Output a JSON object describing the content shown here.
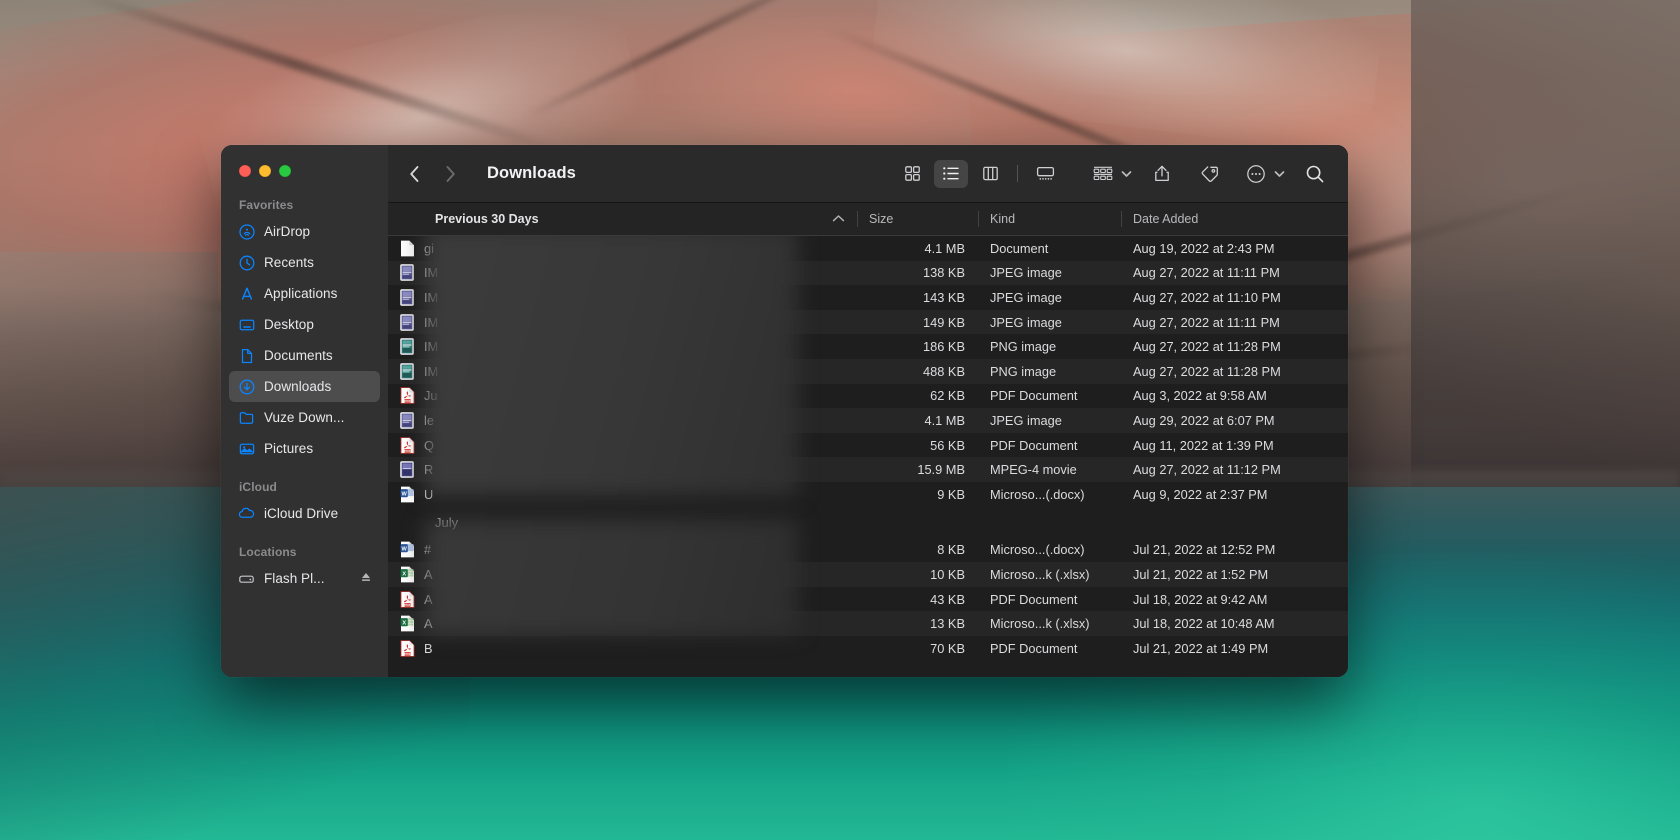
{
  "window": {
    "title": "Downloads",
    "traffic_lights": [
      "close",
      "minimize",
      "zoom"
    ]
  },
  "toolbar": {
    "back_label": "Back",
    "forward_label": "Forward",
    "views": [
      {
        "name": "icon-view",
        "label": "Icon View",
        "active": false
      },
      {
        "name": "list-view",
        "label": "List View",
        "active": true
      },
      {
        "name": "column-view",
        "label": "Column View",
        "active": false
      },
      {
        "name": "gallery-view",
        "label": "Gallery View",
        "active": false
      }
    ],
    "group_label": "Group",
    "share_label": "Share",
    "tag_label": "Tags",
    "more_label": "More",
    "search_label": "Search"
  },
  "sidebar": {
    "sections": [
      {
        "title": "Favorites",
        "items": [
          {
            "label": "AirDrop",
            "icon": "airdrop-icon",
            "selected": false
          },
          {
            "label": "Recents",
            "icon": "clock-icon",
            "selected": false
          },
          {
            "label": "Applications",
            "icon": "applications-icon",
            "selected": false
          },
          {
            "label": "Desktop",
            "icon": "desktop-icon",
            "selected": false
          },
          {
            "label": "Documents",
            "icon": "document-icon",
            "selected": false
          },
          {
            "label": "Downloads",
            "icon": "downloads-icon",
            "selected": true
          },
          {
            "label": "Vuze Down...",
            "icon": "folder-icon",
            "selected": false
          },
          {
            "label": "Pictures",
            "icon": "pictures-icon",
            "selected": false
          }
        ]
      },
      {
        "title": "iCloud",
        "items": [
          {
            "label": "iCloud Drive",
            "icon": "cloud-icon",
            "selected": false
          }
        ]
      },
      {
        "title": "Locations",
        "items": [
          {
            "label": "Flash Pl...",
            "icon": "drive-icon",
            "selected": false,
            "eject": true
          }
        ]
      }
    ]
  },
  "columns": {
    "name": "",
    "size": "Size",
    "kind": "Kind",
    "date_added": "Date Added",
    "sort_direction": "ascending"
  },
  "file_list": {
    "groups": [
      {
        "header": "Previous 30 Days",
        "rows": [
          {
            "name": "gi",
            "icon": "blank-document-icon",
            "size": "4.1 MB",
            "kind": "Document",
            "date": "Aug 19, 2022 at 2:43 PM"
          },
          {
            "name": "IM",
            "icon": "jpeg-thumbnail-icon",
            "size": "138 KB",
            "kind": "JPEG image",
            "date": "Aug 27, 2022 at 11:11 PM"
          },
          {
            "name": "IM",
            "icon": "jpeg-thumbnail-icon",
            "size": "143 KB",
            "kind": "JPEG image",
            "date": "Aug 27, 2022 at 11:10 PM"
          },
          {
            "name": "IM",
            "icon": "jpeg-thumbnail-icon",
            "size": "149 KB",
            "kind": "JPEG image",
            "date": "Aug 27, 2022 at 11:11 PM"
          },
          {
            "name": "IM",
            "icon": "png-thumbnail-icon",
            "size": "186 KB",
            "kind": "PNG image",
            "date": "Aug 27, 2022 at 11:28 PM"
          },
          {
            "name": "IM",
            "icon": "png-thumbnail-icon",
            "size": "488 KB",
            "kind": "PNG image",
            "date": "Aug 27, 2022 at 11:28 PM"
          },
          {
            "name": "Ju",
            "icon": "pdf-icon",
            "size": "62 KB",
            "kind": "PDF Document",
            "date": "Aug 3, 2022 at 9:58 AM"
          },
          {
            "name": "le",
            "icon": "jpeg-thumbnail-icon",
            "size": "4.1 MB",
            "kind": "JPEG image",
            "date": "Aug 29, 2022 at 6:07 PM"
          },
          {
            "name": "Q",
            "icon": "pdf-icon",
            "size": "56 KB",
            "kind": "PDF Document",
            "date": "Aug 11, 2022 at 1:39 PM"
          },
          {
            "name": "R",
            "icon": "movie-thumbnail-icon",
            "size": "15.9 MB",
            "kind": "MPEG-4 movie",
            "date": "Aug 27, 2022 at 11:12 PM"
          },
          {
            "name": "U",
            "icon": "word-icon",
            "size": "9 KB",
            "kind": "Microso...(.docx)",
            "date": "Aug 9, 2022 at 2:37 PM"
          }
        ]
      },
      {
        "header": "July",
        "rows": [
          {
            "name": "#",
            "icon": "word-icon",
            "size": "8 KB",
            "kind": "Microso...(.docx)",
            "date": "Jul 21, 2022 at 12:52 PM"
          },
          {
            "name": "A",
            "icon": "excel-icon",
            "size": "10 KB",
            "kind": "Microso...k (.xlsx)",
            "date": "Jul 21, 2022 at 1:52 PM"
          },
          {
            "name": "A",
            "icon": "pdf-icon",
            "size": "43 KB",
            "kind": "PDF Document",
            "date": "Jul 18, 2022 at 9:42 AM"
          },
          {
            "name": "A",
            "icon": "excel-icon",
            "size": "13 KB",
            "kind": "Microso...k (.xlsx)",
            "date": "Jul 18, 2022 at 10:48 AM"
          },
          {
            "name": "B",
            "icon": "pdf-icon",
            "size": "70 KB",
            "kind": "PDF Document",
            "date": "Jul 21, 2022 at 1:49 PM"
          }
        ]
      }
    ]
  },
  "colors": {
    "sidebar_accent": "#0a84ff",
    "window_bg": "#1e1e1e",
    "toolbar_bg": "#2a2a2a",
    "row_stripe": "#262626",
    "selection": "rgba(255,255,255,.14)",
    "traffic_red": "#ff5f57",
    "traffic_yellow": "#febc2e",
    "traffic_green": "#28c840"
  }
}
